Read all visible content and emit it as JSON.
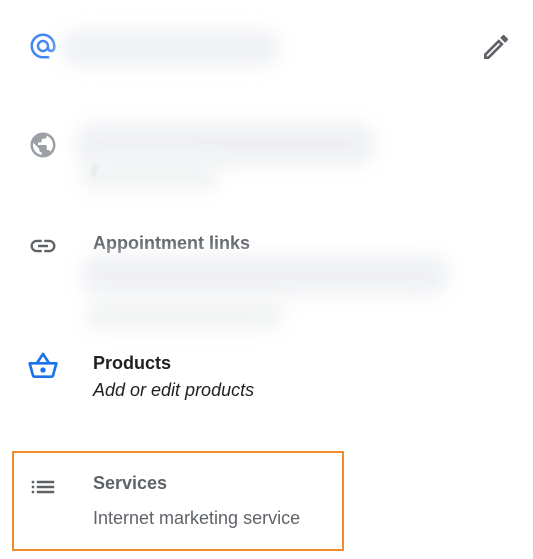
{
  "rows": {
    "email": {
      "icon": "at-sign-icon",
      "accent": "#4285f4"
    },
    "edit": {
      "icon": "pencil-icon"
    },
    "website": {
      "icon": "globe-icon",
      "prefix_char": "/"
    },
    "appointment_links": {
      "icon": "link-icon",
      "label": "Appointment links"
    },
    "products": {
      "icon": "basket-icon",
      "label": "Products",
      "sub": "Add or edit products",
      "accent": "#1a73e8"
    },
    "services": {
      "icon": "list-icon",
      "label": "Services",
      "sub": "Internet marketing service",
      "highlight_color": "#f28c2b"
    }
  }
}
